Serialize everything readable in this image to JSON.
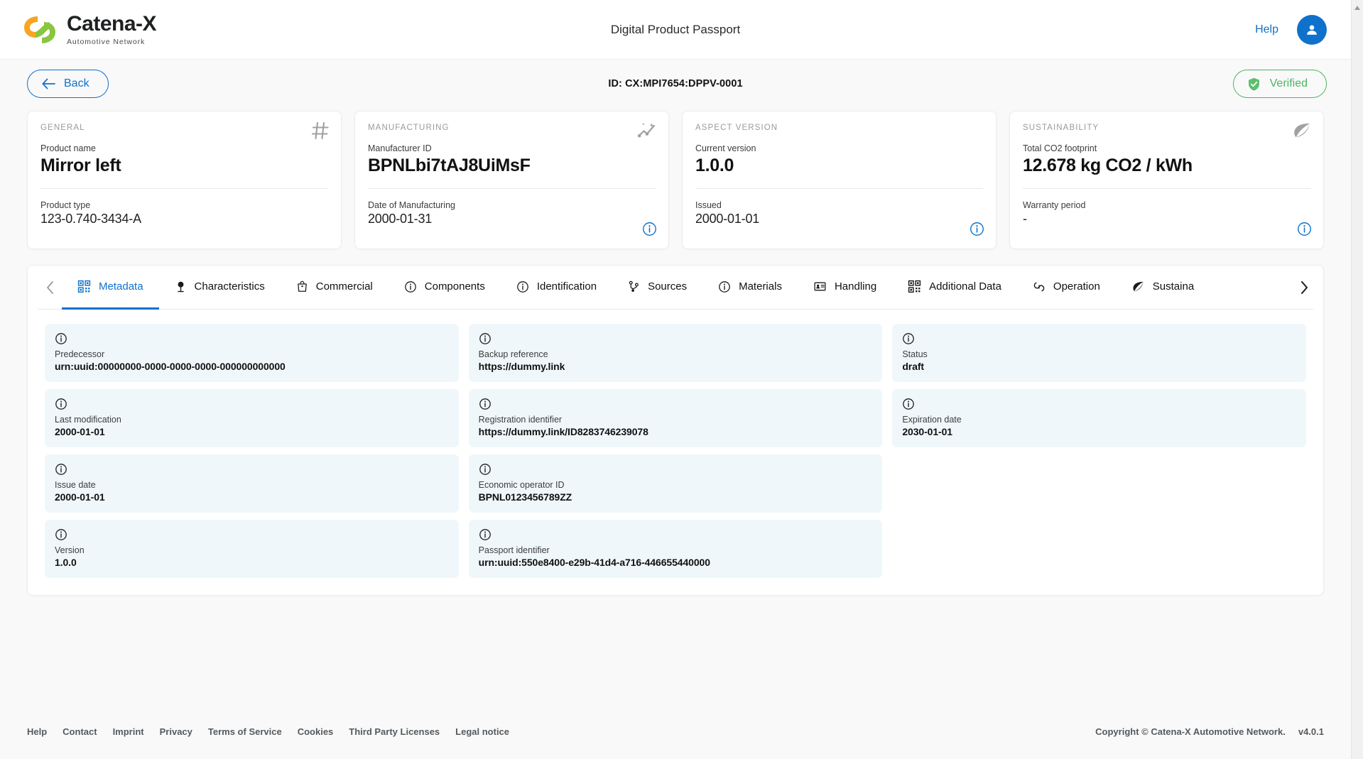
{
  "header": {
    "logo_name": "Catena-X",
    "logo_sub": "Automotive Network",
    "title": "Digital Product Passport",
    "help_label": "Help",
    "avatar_icon": "user-icon"
  },
  "subbar": {
    "back_label": "Back",
    "back_icon": "arrow-left-icon",
    "document_id": "ID: CX:MPI7654:DPPV-0001",
    "verified_label": "Verified",
    "verified_icon": "shield-check-icon",
    "verified_color": "#4bb563",
    "accent_color": "#0f71cb"
  },
  "cards": [
    {
      "heading": "GENERAL",
      "icon": "hash-icon",
      "primary_label": "Product name",
      "primary_value": "Mirror left",
      "secondary_label": "Product type",
      "secondary_value": "123-0.740-3434-A",
      "has_info": false
    },
    {
      "heading": "MANUFACTURING",
      "icon": "trend-sparkle-icon",
      "primary_label": "Manufacturer ID",
      "primary_value": "BPNLbi7tAJ8UiMsF",
      "secondary_label": "Date of Manufacturing",
      "secondary_value": "2000-01-31",
      "has_info": true
    },
    {
      "heading": "ASPECT VERSION",
      "icon": "",
      "primary_label": "Current version",
      "primary_value": "1.0.0",
      "secondary_label": "Issued",
      "secondary_value": "2000-01-01",
      "has_info": true
    },
    {
      "heading": "SUSTAINABILITY",
      "icon": "leaf-icon",
      "primary_label": "Total CO2 footprint",
      "primary_value": "12.678 kg CO2 / kWh",
      "secondary_label": "Warranty period",
      "secondary_value": "-",
      "has_info": true
    }
  ],
  "tabs": {
    "prev_icon": "chevron-left-icon",
    "next_icon": "chevron-right-icon",
    "items": [
      {
        "label": "Metadata",
        "icon": "qr-code-icon",
        "active": true
      },
      {
        "label": "Characteristics",
        "icon": "pin-icon",
        "active": false
      },
      {
        "label": "Commercial",
        "icon": "bag-icon",
        "active": false
      },
      {
        "label": "Components",
        "icon": "info-icon",
        "active": false
      },
      {
        "label": "Identification",
        "icon": "info-icon",
        "active": false
      },
      {
        "label": "Sources",
        "icon": "branch-icon",
        "active": false
      },
      {
        "label": "Materials",
        "icon": "info-icon",
        "active": false
      },
      {
        "label": "Handling",
        "icon": "id-card-icon",
        "active": false
      },
      {
        "label": "Additional Data",
        "icon": "qr-code-icon",
        "active": false
      },
      {
        "label": "Operation",
        "icon": "recycle-icon",
        "active": false
      },
      {
        "label": "Sustaina",
        "icon": "leaf-icon",
        "active": false
      }
    ]
  },
  "fields": [
    {
      "icon": "info-icon",
      "label": "Predecessor",
      "value": "urn:uuid:00000000-0000-0000-0000-000000000000"
    },
    {
      "icon": "info-icon",
      "label": "Backup reference",
      "value": "https://dummy.link"
    },
    {
      "icon": "info-icon",
      "label": "Status",
      "value": "draft"
    },
    {
      "icon": "info-icon",
      "label": "Last modification",
      "value": "2000-01-01"
    },
    {
      "icon": "info-icon",
      "label": "Registration identifier",
      "value": "https://dummy.link/ID8283746239078"
    },
    {
      "icon": "info-icon",
      "label": "Expiration date",
      "value": "2030-01-01"
    },
    {
      "icon": "info-icon",
      "label": "Issue date",
      "value": "2000-01-01"
    },
    {
      "icon": "info-icon",
      "label": "Economic operator ID",
      "value": "BPNL0123456789ZZ"
    },
    {
      "icon": "",
      "label": "",
      "value": ""
    },
    {
      "icon": "info-icon",
      "label": "Version",
      "value": "1.0.0"
    },
    {
      "icon": "info-icon",
      "label": "Passport identifier",
      "value": "urn:uuid:550e8400-e29b-41d4-a716-446655440000"
    },
    {
      "icon": "",
      "label": "",
      "value": ""
    }
  ],
  "footer": {
    "links": [
      "Help",
      "Contact",
      "Imprint",
      "Privacy",
      "Terms of Service",
      "Cookies",
      "Third Party Licenses",
      "Legal notice"
    ],
    "copyright": "Copyright © Catena-X Automotive Network.",
    "version": "v4.0.1"
  }
}
